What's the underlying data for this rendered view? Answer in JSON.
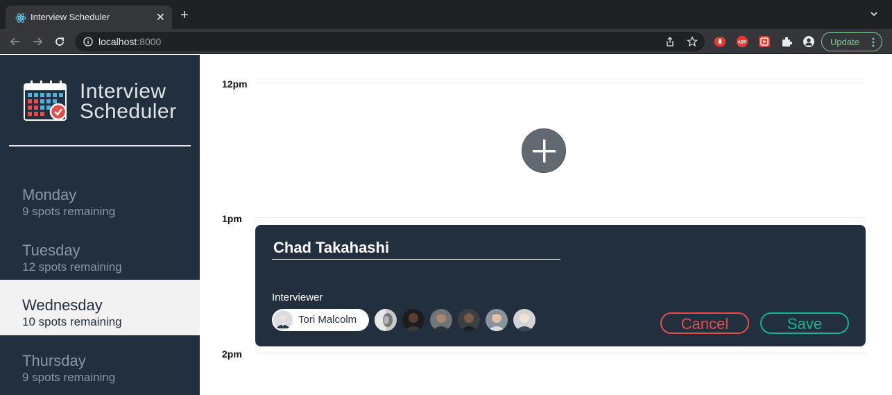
{
  "browser": {
    "tab_title": "Interview Scheduler",
    "tab_close": "✕",
    "new_tab": "+",
    "url_host": "localhost",
    "url_port": ":8000",
    "update_label": "Update"
  },
  "app": {
    "logo_line1": "Interview",
    "logo_line2": "Scheduler",
    "days": [
      {
        "name": "Monday",
        "spots": "9 spots remaining"
      },
      {
        "name": "Tuesday",
        "spots": "12 spots remaining"
      },
      {
        "name": "Wednesday",
        "spots": "10 spots remaining"
      },
      {
        "name": "Thursday",
        "spots": "9 spots remaining"
      }
    ],
    "times": [
      "12pm",
      "1pm",
      "2pm"
    ],
    "form": {
      "student_name": "Chad Takahashi",
      "interviewer_label": "Interviewer",
      "selected_interviewer": "Tori Malcolm",
      "cancel_label": "Cancel",
      "save_label": "Save"
    }
  },
  "colors": {
    "sidebar_bg": "#222f3e",
    "cancel": "#e24e4b",
    "save": "#13b58f",
    "selected_day_bg": "#f2f2f2"
  }
}
